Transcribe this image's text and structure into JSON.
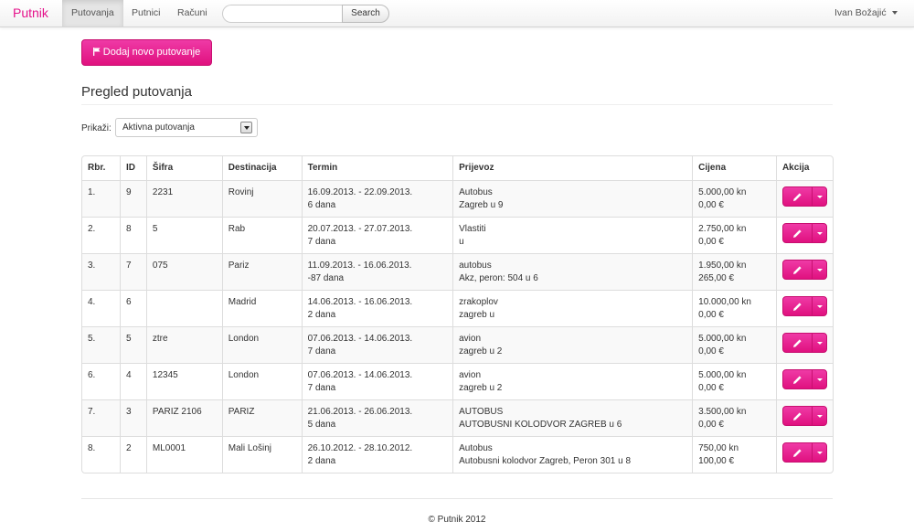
{
  "navbar": {
    "brand": "Putnik",
    "items": [
      {
        "label": "Putovanja",
        "active": true
      },
      {
        "label": "Putnici",
        "active": false
      },
      {
        "label": "Računi",
        "active": false
      }
    ],
    "search": {
      "value": "",
      "placeholder": "",
      "button_label": "Search"
    },
    "user": "Ivan Božajić"
  },
  "toolbar": {
    "add_label": "Dodaj novo putovanje",
    "add_icon": "flag-icon"
  },
  "page_title": "Pregled putovanja",
  "filter": {
    "label": "Prikaži:",
    "selected": "Aktivna putovanja"
  },
  "table": {
    "headers": [
      "Rbr.",
      "ID",
      "Šifra",
      "Destinacija",
      "Termin",
      "Prijevoz",
      "Cijena",
      "Akcija"
    ],
    "rows": [
      {
        "rbr": "1.",
        "id": "9",
        "sifra": "2231",
        "destinacija": "Rovinj",
        "termin": "16.09.2013. - 22.09.2013.",
        "trajanje": "6 dana",
        "prijevoz": "Autobus",
        "polazak": "Zagreb u 9",
        "cijena_kn": "5.000,00 kn",
        "cijena_eur": "0,00 €"
      },
      {
        "rbr": "2.",
        "id": "8",
        "sifra": "5",
        "destinacija": "Rab",
        "termin": "20.07.2013. - 27.07.2013.",
        "trajanje": "7 dana",
        "prijevoz": "Vlastiti",
        "polazak": "u",
        "cijena_kn": "2.750,00 kn",
        "cijena_eur": "0,00 €"
      },
      {
        "rbr": "3.",
        "id": "7",
        "sifra": "075",
        "destinacija": "Pariz",
        "termin": "11.09.2013. - 16.06.2013.",
        "trajanje": "-87 dana",
        "prijevoz": "autobus",
        "polazak": "Akz, peron: 504 u 6",
        "cijena_kn": "1.950,00 kn",
        "cijena_eur": "265,00 €"
      },
      {
        "rbr": "4.",
        "id": "6",
        "sifra": "",
        "destinacija": "Madrid",
        "termin": "14.06.2013. - 16.06.2013.",
        "trajanje": "2 dana",
        "prijevoz": "zrakoplov",
        "polazak": "zagreb u",
        "cijena_kn": "10.000,00 kn",
        "cijena_eur": "0,00 €"
      },
      {
        "rbr": "5.",
        "id": "5",
        "sifra": "ztre",
        "destinacija": "London",
        "termin": "07.06.2013. - 14.06.2013.",
        "trajanje": "7 dana",
        "prijevoz": "avion",
        "polazak": "zagreb u 2",
        "cijena_kn": "5.000,00 kn",
        "cijena_eur": "0,00 €"
      },
      {
        "rbr": "6.",
        "id": "4",
        "sifra": "12345",
        "destinacija": "London",
        "termin": "07.06.2013. - 14.06.2013.",
        "trajanje": "7 dana",
        "prijevoz": "avion",
        "polazak": "zagreb u 2",
        "cijena_kn": "5.000,00 kn",
        "cijena_eur": "0,00 €"
      },
      {
        "rbr": "7.",
        "id": "3",
        "sifra": "PARIZ 2106",
        "destinacija": "PARIZ",
        "termin": "21.06.2013. - 26.06.2013.",
        "trajanje": "5 dana",
        "prijevoz": "AUTOBUS",
        "polazak": "AUTOBUSNI KOLODVOR ZAGREB u 6",
        "cijena_kn": "3.500,00 kn",
        "cijena_eur": "0,00 €"
      },
      {
        "rbr": "8.",
        "id": "2",
        "sifra": "ML0001",
        "destinacija": "Mali Lošinj",
        "termin": "26.10.2012. - 28.10.2012.",
        "trajanje": "2 dana",
        "prijevoz": "Autobus",
        "polazak": "Autobusni kolodvor Zagreb, Peron 301 u 8",
        "cijena_kn": "750,00 kn",
        "cijena_eur": "100,00 €"
      }
    ]
  },
  "footer": "© Putnik 2012",
  "colors": {
    "accent": "#e5118b",
    "button": "#e0117f"
  }
}
